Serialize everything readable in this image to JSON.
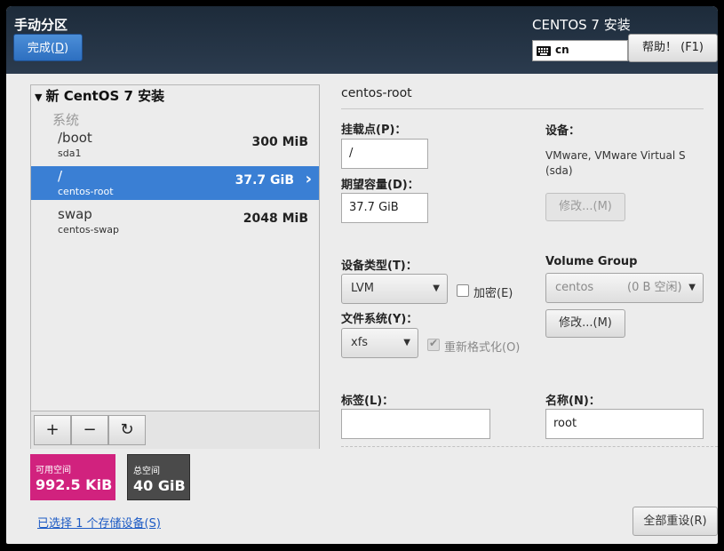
{
  "header": {
    "title": "手动分区",
    "done_label": "完成(",
    "done_key": "D",
    "done_tail": ")",
    "product": "CENTOS 7 安装",
    "keyboard_layout": "cn",
    "help_label": "帮助！ (F1)"
  },
  "tree": {
    "root_label": "新 CentOS 7 安装",
    "group_label": "系统",
    "mounts": [
      {
        "name": "/boot",
        "device": "sda1",
        "size": "300 MiB"
      },
      {
        "name": "/",
        "device": "centos-root",
        "size": "37.7 GiB",
        "selected": true
      },
      {
        "name": "swap",
        "device": "centos-swap",
        "size": "2048 MiB"
      }
    ],
    "toolbar": {
      "add": "+",
      "remove": "−",
      "refresh": "↻"
    }
  },
  "space": {
    "available_label": "可用空间",
    "available_value": "992.5 KiB",
    "total_label": "总空间",
    "total_value": "40 GiB"
  },
  "storage_link": "已选择 1 个存储设备(S)",
  "detail": {
    "title": "centos-root",
    "mount_point_label": "挂载点(P)：",
    "mount_point_value": "/",
    "capacity_label": "期望容量(D)：",
    "capacity_value": "37.7 GiB",
    "device_label": "设备：",
    "device_desc": "VMware, VMware Virtual S (sda)",
    "modify_label": "修改...(M)",
    "device_type_label": "设备类型(T)：",
    "device_type_value": "LVM",
    "encrypt_label": "加密(E)",
    "fs_label": "文件系统(Y)：",
    "fs_value": "xfs",
    "reformat_label": "重新格式化(O)",
    "vg_label": "Volume Group",
    "vg_value": "centos",
    "vg_free": "(0 B 空闲)",
    "vg_modify_label": "修改...(M)",
    "tag_label": "标签(L)：",
    "tag_value": "",
    "name_label": "名称(N)：",
    "name_value": "root",
    "reset_label": "全部重设(R)"
  },
  "colors": {
    "accent": "#3a7fd4",
    "available": "#d1227e",
    "total": "#4a4a4a",
    "header": "#1d2b3a"
  }
}
